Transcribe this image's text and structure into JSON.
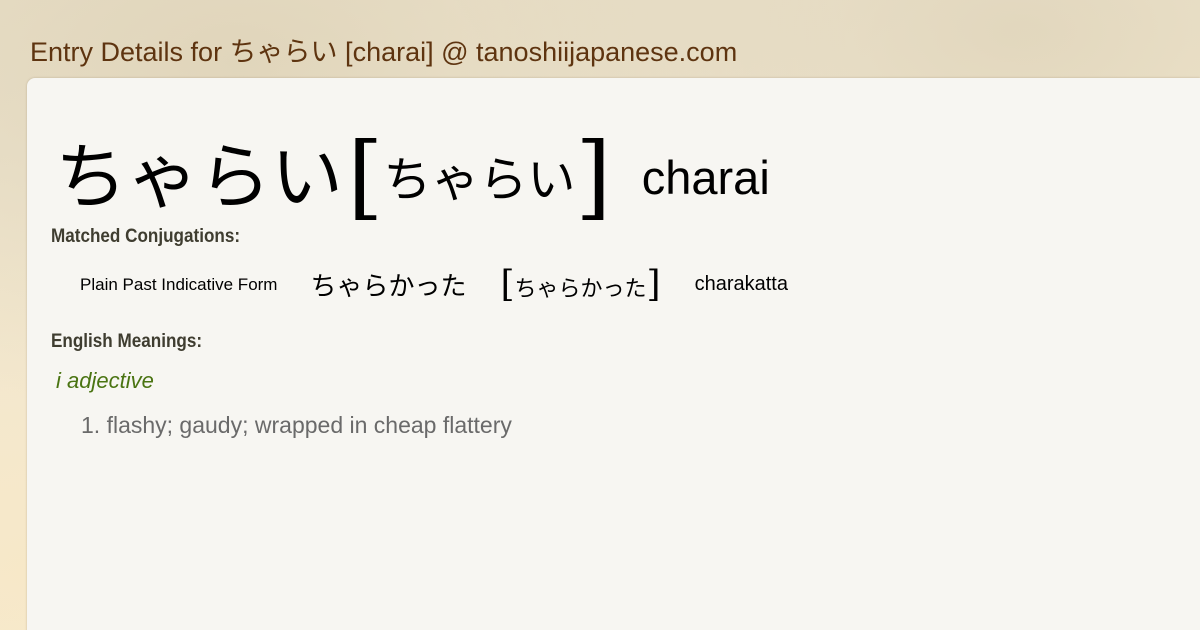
{
  "page": {
    "title": "Entry Details for ちゃらい [charai] @ tanoshiijapanese.com"
  },
  "entry": {
    "kanji_form": "ちゃらい",
    "bracket_open": "[",
    "reading": "ちゃらい",
    "bracket_close": "]",
    "romaji": "charai"
  },
  "conjugations": {
    "label": "Matched Conjugations:",
    "items": [
      {
        "form_type": "Plain Past Indicative Form",
        "kana": "ちゃらかった",
        "bracket_open": "[",
        "reading": "ちゃらかった",
        "bracket_close": "]",
        "romaji": "charakatta"
      }
    ]
  },
  "meanings": {
    "label": "English Meanings:",
    "part_of_speech": "i adjective",
    "definitions": [
      "1. flashy; gaudy; wrapped in cheap flattery"
    ]
  },
  "colors": {
    "title": "#5e3410",
    "part_of_speech": "#4a7412",
    "definition_text": "#6a6a6a",
    "panel_background": "#f7f6f2"
  }
}
